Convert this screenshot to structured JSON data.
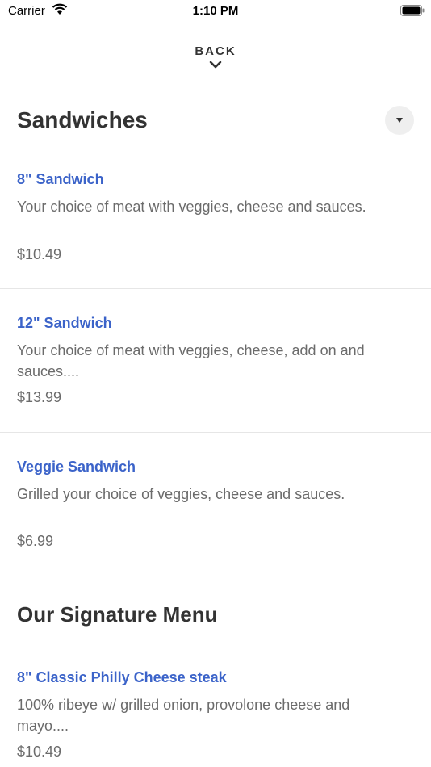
{
  "status_bar": {
    "carrier": "Carrier",
    "time": "1:10 PM"
  },
  "nav": {
    "back_label": "BACK"
  },
  "sections": [
    {
      "title": "Sandwiches",
      "items": [
        {
          "name": "8\" Sandwich",
          "description": "Your choice of meat with veggies, cheese and sauces.",
          "price": "$10.49"
        },
        {
          "name": "12\" Sandwich",
          "description_line1": "Your choice of meat with veggies, cheese, add on and",
          "description_line2": "sauces....",
          "price": "$13.99"
        },
        {
          "name": "Veggie Sandwich",
          "description": "Grilled your choice of veggies, cheese and sauces.",
          "price": "$6.99"
        }
      ]
    },
    {
      "title": "Our Signature Menu",
      "items": [
        {
          "name": "8\" Classic Philly Cheese steak",
          "description_line1": "100% ribeye w/ grilled onion, provolone cheese and",
          "description_line2": "mayo....",
          "price": "$10.49"
        }
      ]
    }
  ],
  "colors": {
    "item_name": "#3b63c9",
    "text_secondary": "#6b6b6b",
    "heading": "#333333",
    "divider": "#e6e6e6"
  }
}
